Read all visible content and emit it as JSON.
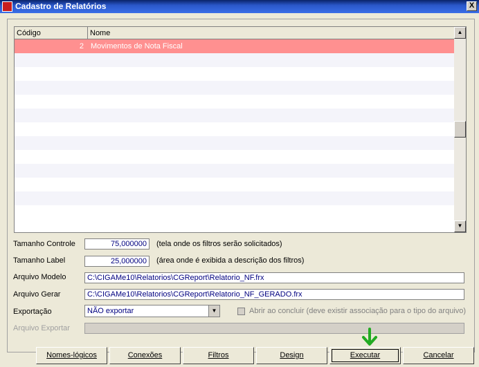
{
  "window": {
    "title": "Cadastro de Relatórios",
    "close_glyph": "X"
  },
  "grid": {
    "columns": [
      "Código",
      "Nome"
    ],
    "rows": [
      {
        "codigo": "2",
        "nome": "Movimentos de Nota Fiscal",
        "selected": true
      }
    ],
    "empty_rows": 12
  },
  "form": {
    "tamanho_controle": {
      "label": "Tamanho Controle",
      "value": "75,000000",
      "hint": "(tela onde os filtros serão solicitados)"
    },
    "tamanho_label": {
      "label": "Tamanho Label",
      "value": "25,000000",
      "hint": "(área onde é exibida a descrição dos filtros)"
    },
    "arquivo_modelo": {
      "label": "Arquivo Modelo",
      "value": "C:\\CIGAMe10\\Relatorios\\CGReport\\Relatorio_NF.frx"
    },
    "arquivo_gerar": {
      "label": "Arquivo Gerar",
      "value": "C:\\CIGAMe10\\Relatorios\\CGReport\\Relatorio_NF_GERADO.frx"
    },
    "exportacao": {
      "label": "Exportação",
      "value": "NÃO exportar"
    },
    "abrir_concluir": {
      "label": "Abrir ao concluir (deve existir associação para o tipo do arquivo)"
    },
    "arquivo_exportar": {
      "label": "Arquivo Exportar",
      "value": ""
    }
  },
  "buttons": {
    "nomes_logicos": "Nomes-lógicos",
    "conexoes": "Conexões",
    "filtros": "Filtros",
    "design": "Design",
    "executar": "Executar",
    "cancelar": "Cancelar"
  },
  "colors": {
    "selected_row": "#ff9090",
    "title_bar": "#0a246a",
    "arrow": "#22aa22"
  }
}
